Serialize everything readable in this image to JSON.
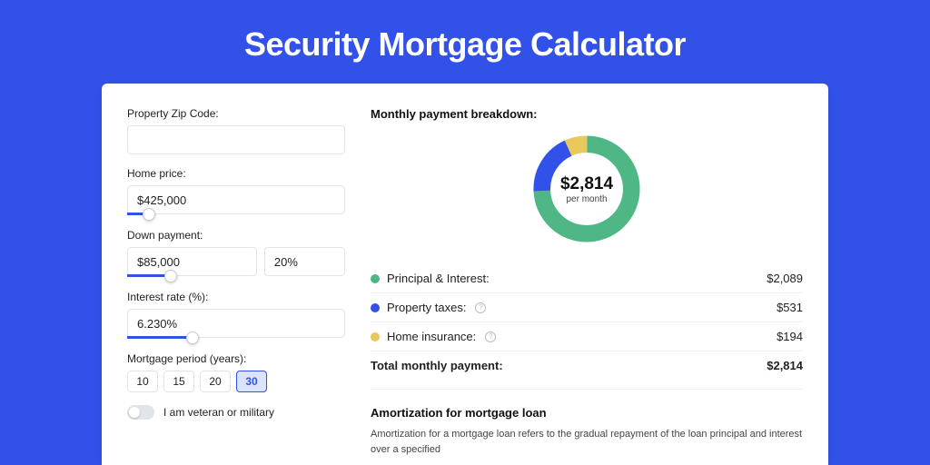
{
  "title": "Security Mortgage Calculator",
  "form": {
    "zip_label": "Property Zip Code:",
    "zip_value": "",
    "home_price_label": "Home price:",
    "home_price_value": "$425,000",
    "home_price_slider_pct": 10,
    "down_payment_label": "Down payment:",
    "down_payment_value": "$85,000",
    "down_payment_pct": "20%",
    "down_payment_slider_pct": 20,
    "interest_label": "Interest rate (%):",
    "interest_value": "6.230%",
    "interest_slider_pct": 30,
    "period_label": "Mortgage period (years):",
    "periods": [
      {
        "label": "10",
        "active": false
      },
      {
        "label": "15",
        "active": false
      },
      {
        "label": "20",
        "active": false
      },
      {
        "label": "30",
        "active": true
      }
    ],
    "veteran_label": "I am veteran or military",
    "veteran_on": false
  },
  "breakdown": {
    "title": "Monthly payment breakdown:",
    "center_value": "$2,814",
    "center_sub": "per month",
    "items": [
      {
        "key": "principal",
        "label": "Principal & Interest:",
        "value": "$2,089",
        "color": "green",
        "info": false
      },
      {
        "key": "taxes",
        "label": "Property taxes:",
        "value": "$531",
        "color": "blue",
        "info": true
      },
      {
        "key": "insurance",
        "label": "Home insurance:",
        "value": "$194",
        "color": "yellow",
        "info": true
      }
    ],
    "total_label": "Total monthly payment:",
    "total_value": "$2,814"
  },
  "chart_data": {
    "type": "pie",
    "title": "Monthly payment breakdown",
    "series": [
      {
        "name": "Principal & Interest",
        "value": 2089,
        "color": "#4fb686"
      },
      {
        "name": "Property taxes",
        "value": 531,
        "color": "#3251e8"
      },
      {
        "name": "Home insurance",
        "value": 194,
        "color": "#e8c95b"
      }
    ],
    "total": 2814,
    "center_label": "$2,814 per month"
  },
  "amortization": {
    "title": "Amortization for mortgage loan",
    "text": "Amortization for a mortgage loan refers to the gradual repayment of the loan principal and interest over a specified"
  }
}
